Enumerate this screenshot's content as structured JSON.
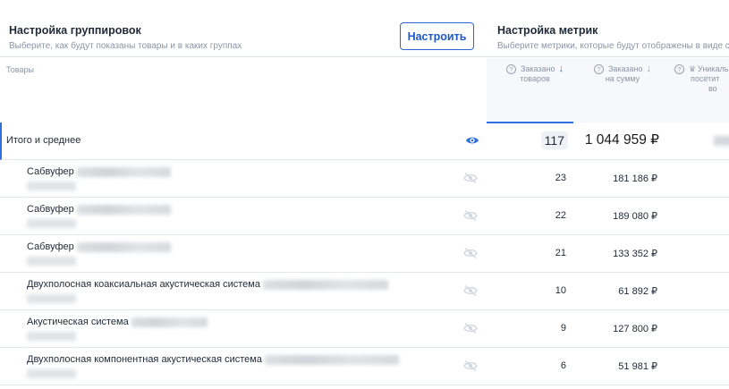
{
  "groups": {
    "title": "Настройка группировок",
    "subtitle": "Выберите, как будут показаны товары и в каких группах",
    "button": "Настроить"
  },
  "metrics": {
    "title": "Настройка метрик",
    "subtitle": "Выберите метрики, которые будут отображены в виде ст"
  },
  "table": {
    "goods_header": "Товары",
    "columns": [
      {
        "line1": "Заказано",
        "line2": "товаров"
      },
      {
        "line1": "Заказано",
        "line2": "на сумму"
      },
      {
        "line1": "Уникаль",
        "line2": "посетит",
        "line3": "во"
      }
    ],
    "total": {
      "label": "Итого и среднее",
      "qty": "117",
      "sum": "1 044 959 ₽"
    },
    "rows": [
      {
        "name": "Сабвуфер",
        "qty": "23",
        "sum": "181 186 ₽"
      },
      {
        "name": "Сабвуфер",
        "qty": "22",
        "sum": "189 080 ₽"
      },
      {
        "name": "Сабвуфер",
        "qty": "21",
        "sum": "133 352 ₽"
      },
      {
        "name": "Двухполосная коаксиальная акустическая система",
        "qty": "10",
        "sum": "61 892 ₽"
      },
      {
        "name": "Акустическая система",
        "qty": "9",
        "sum": "127 800 ₽"
      },
      {
        "name": "Двухполосная компонентная акустическая система",
        "qty": "6",
        "sum": "51 981 ₽"
      }
    ]
  },
  "icons": {
    "eye_active": "eye-icon",
    "eye_hidden": "eye-off-icon",
    "help": "question-icon",
    "sort": "arrow-down-icon",
    "premium": "crown-icon"
  },
  "colors": {
    "accent": "#2f6fde",
    "muted": "#8b95a5",
    "border": "#dde3ea"
  }
}
